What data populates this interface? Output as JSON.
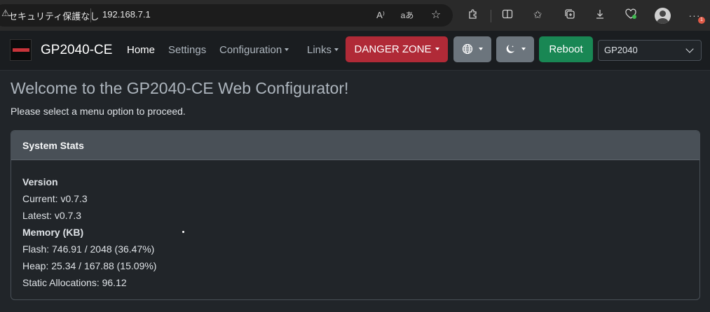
{
  "browser": {
    "security_label": "セキュリティ保護なし",
    "url": "192.168.7.1",
    "icons": [
      "read-aloud-icon",
      "translate-icon",
      "favorite-icon",
      "extensions-icon",
      "split-screen-icon",
      "favorites-icon",
      "collections-icon",
      "downloads-icon",
      "browser-essentials-icon",
      "profile-icon",
      "more-icon"
    ],
    "read_aloud_glyph": "A⁾",
    "translate_glyph": "aあ",
    "notification_count": "1"
  },
  "navbar": {
    "brand": "GP2040-CE",
    "links": {
      "home": "Home",
      "settings": "Settings",
      "configuration": "Configuration",
      "links": "Links"
    },
    "danger_zone": "DANGER ZONE",
    "reboot": "Reboot",
    "board_select": "GP2040"
  },
  "main": {
    "title": "Welcome to the GP2040-CE Web Configurator!",
    "subtitle": "Please select a menu option to proceed.",
    "card": {
      "header": "System Stats",
      "version_heading": "Version",
      "current": "Current: v0.7.3",
      "latest": "Latest: v0.7.3",
      "memory_heading": "Memory (KB)",
      "flash": "Flash: 746.91 / 2048 (36.47%)",
      "heap": "Heap: 25.34 / 167.88 (15.09%)",
      "static_alloc": "Static Allocations: 96.12"
    }
  },
  "colors": {
    "danger": "#b02a37",
    "success": "#198754",
    "secondary": "#6c757d",
    "body_bg": "#212529"
  }
}
